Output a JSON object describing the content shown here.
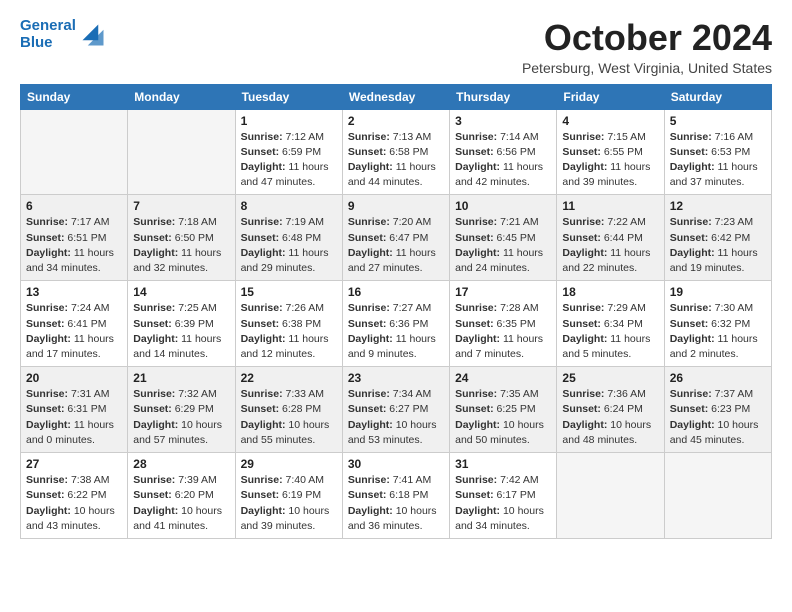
{
  "logo": {
    "line1": "General",
    "line2": "Blue"
  },
  "title": "October 2024",
  "location": "Petersburg, West Virginia, United States",
  "days_of_week": [
    "Sunday",
    "Monday",
    "Tuesday",
    "Wednesday",
    "Thursday",
    "Friday",
    "Saturday"
  ],
  "weeks": [
    [
      {
        "day": "",
        "info": ""
      },
      {
        "day": "",
        "info": ""
      },
      {
        "day": "1",
        "info": "Sunrise: 7:12 AM\nSunset: 6:59 PM\nDaylight: 11 hours and 47 minutes."
      },
      {
        "day": "2",
        "info": "Sunrise: 7:13 AM\nSunset: 6:58 PM\nDaylight: 11 hours and 44 minutes."
      },
      {
        "day": "3",
        "info": "Sunrise: 7:14 AM\nSunset: 6:56 PM\nDaylight: 11 hours and 42 minutes."
      },
      {
        "day": "4",
        "info": "Sunrise: 7:15 AM\nSunset: 6:55 PM\nDaylight: 11 hours and 39 minutes."
      },
      {
        "day": "5",
        "info": "Sunrise: 7:16 AM\nSunset: 6:53 PM\nDaylight: 11 hours and 37 minutes."
      }
    ],
    [
      {
        "day": "6",
        "info": "Sunrise: 7:17 AM\nSunset: 6:51 PM\nDaylight: 11 hours and 34 minutes."
      },
      {
        "day": "7",
        "info": "Sunrise: 7:18 AM\nSunset: 6:50 PM\nDaylight: 11 hours and 32 minutes."
      },
      {
        "day": "8",
        "info": "Sunrise: 7:19 AM\nSunset: 6:48 PM\nDaylight: 11 hours and 29 minutes."
      },
      {
        "day": "9",
        "info": "Sunrise: 7:20 AM\nSunset: 6:47 PM\nDaylight: 11 hours and 27 minutes."
      },
      {
        "day": "10",
        "info": "Sunrise: 7:21 AM\nSunset: 6:45 PM\nDaylight: 11 hours and 24 minutes."
      },
      {
        "day": "11",
        "info": "Sunrise: 7:22 AM\nSunset: 6:44 PM\nDaylight: 11 hours and 22 minutes."
      },
      {
        "day": "12",
        "info": "Sunrise: 7:23 AM\nSunset: 6:42 PM\nDaylight: 11 hours and 19 minutes."
      }
    ],
    [
      {
        "day": "13",
        "info": "Sunrise: 7:24 AM\nSunset: 6:41 PM\nDaylight: 11 hours and 17 minutes."
      },
      {
        "day": "14",
        "info": "Sunrise: 7:25 AM\nSunset: 6:39 PM\nDaylight: 11 hours and 14 minutes."
      },
      {
        "day": "15",
        "info": "Sunrise: 7:26 AM\nSunset: 6:38 PM\nDaylight: 11 hours and 12 minutes."
      },
      {
        "day": "16",
        "info": "Sunrise: 7:27 AM\nSunset: 6:36 PM\nDaylight: 11 hours and 9 minutes."
      },
      {
        "day": "17",
        "info": "Sunrise: 7:28 AM\nSunset: 6:35 PM\nDaylight: 11 hours and 7 minutes."
      },
      {
        "day": "18",
        "info": "Sunrise: 7:29 AM\nSunset: 6:34 PM\nDaylight: 11 hours and 5 minutes."
      },
      {
        "day": "19",
        "info": "Sunrise: 7:30 AM\nSunset: 6:32 PM\nDaylight: 11 hours and 2 minutes."
      }
    ],
    [
      {
        "day": "20",
        "info": "Sunrise: 7:31 AM\nSunset: 6:31 PM\nDaylight: 11 hours and 0 minutes."
      },
      {
        "day": "21",
        "info": "Sunrise: 7:32 AM\nSunset: 6:29 PM\nDaylight: 10 hours and 57 minutes."
      },
      {
        "day": "22",
        "info": "Sunrise: 7:33 AM\nSunset: 6:28 PM\nDaylight: 10 hours and 55 minutes."
      },
      {
        "day": "23",
        "info": "Sunrise: 7:34 AM\nSunset: 6:27 PM\nDaylight: 10 hours and 53 minutes."
      },
      {
        "day": "24",
        "info": "Sunrise: 7:35 AM\nSunset: 6:25 PM\nDaylight: 10 hours and 50 minutes."
      },
      {
        "day": "25",
        "info": "Sunrise: 7:36 AM\nSunset: 6:24 PM\nDaylight: 10 hours and 48 minutes."
      },
      {
        "day": "26",
        "info": "Sunrise: 7:37 AM\nSunset: 6:23 PM\nDaylight: 10 hours and 45 minutes."
      }
    ],
    [
      {
        "day": "27",
        "info": "Sunrise: 7:38 AM\nSunset: 6:22 PM\nDaylight: 10 hours and 43 minutes."
      },
      {
        "day": "28",
        "info": "Sunrise: 7:39 AM\nSunset: 6:20 PM\nDaylight: 10 hours and 41 minutes."
      },
      {
        "day": "29",
        "info": "Sunrise: 7:40 AM\nSunset: 6:19 PM\nDaylight: 10 hours and 39 minutes."
      },
      {
        "day": "30",
        "info": "Sunrise: 7:41 AM\nSunset: 6:18 PM\nDaylight: 10 hours and 36 minutes."
      },
      {
        "day": "31",
        "info": "Sunrise: 7:42 AM\nSunset: 6:17 PM\nDaylight: 10 hours and 34 minutes."
      },
      {
        "day": "",
        "info": ""
      },
      {
        "day": "",
        "info": ""
      }
    ]
  ]
}
